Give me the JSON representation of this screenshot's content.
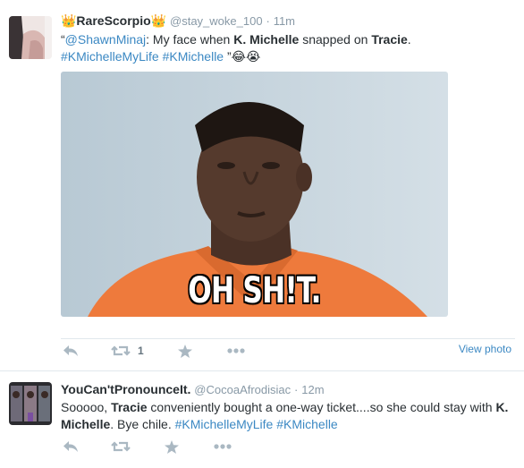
{
  "tweets": [
    {
      "name": "👑RareScorpio👑",
      "handle": "@stay_woke_100",
      "separator": "·",
      "time": "11m",
      "text_parts": {
        "p1": "“",
        "mention": "@ShawnMinaj",
        "p2": ": My face when ",
        "b1": "K. Michelle",
        "p3": " snapped on ",
        "b2": "Tracie",
        "p4": ".",
        "h1": "#KMichelleMyLife",
        "p5": " ",
        "h2": "#KMichelle",
        "p6": " ”😂😭"
      },
      "media_caption": "OH SH!T.",
      "retweet_count": "1",
      "view_photo": "View photo"
    },
    {
      "name": "YouCan'tPronounceIt.",
      "handle": "@CocoaAfrodisiac",
      "separator": "·",
      "time": "12m",
      "text_parts": {
        "p1": "Sooooo, ",
        "b1": "Tracie",
        "p2": " conveniently bought a one-way ticket....so she could stay with ",
        "b2": "K. Michelle",
        "p3": ". Bye chile. ",
        "h1": "#KMichelleMyLife",
        "p4": " ",
        "h2": "#KMichelle"
      }
    }
  ],
  "icons": [
    "reply-icon",
    "retweet-icon",
    "favorite-icon",
    "more-icon"
  ],
  "colors": {
    "link": "#3b88c3",
    "action_gray": "#aab8c2",
    "meta_gray": "#8899a6"
  }
}
